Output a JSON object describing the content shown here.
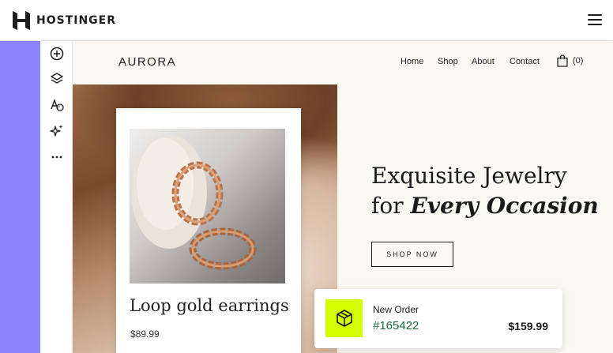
{
  "header": {
    "logo_text": "HOSTINGER",
    "menu_icon": "hamburger-menu-icon"
  },
  "sidebar": {
    "tools": [
      {
        "icon": "add-circle-icon"
      },
      {
        "icon": "layers-icon"
      },
      {
        "icon": "typography-palette-icon"
      },
      {
        "icon": "ai-sparkle-icon"
      },
      {
        "icon": "more-dots-icon"
      }
    ],
    "accent_color": "#8c85ff"
  },
  "site": {
    "brand": "AURORA",
    "nav": [
      "Home",
      "Shop",
      "About",
      "Contact"
    ],
    "cart_count": "(0)",
    "product": {
      "title": "Loop gold earrings",
      "price": "$89.99"
    },
    "hero": {
      "line1": "Exquisite Jewelry",
      "line2_prefix": "for ",
      "line2_emphasis": "Every Occasion"
    },
    "shop_button": "SHOP NOW"
  },
  "order_notification": {
    "label": "New Order",
    "number": "#165422",
    "total": "$159.99",
    "icon": "package-box-icon",
    "icon_bg": "#d5ff00"
  }
}
